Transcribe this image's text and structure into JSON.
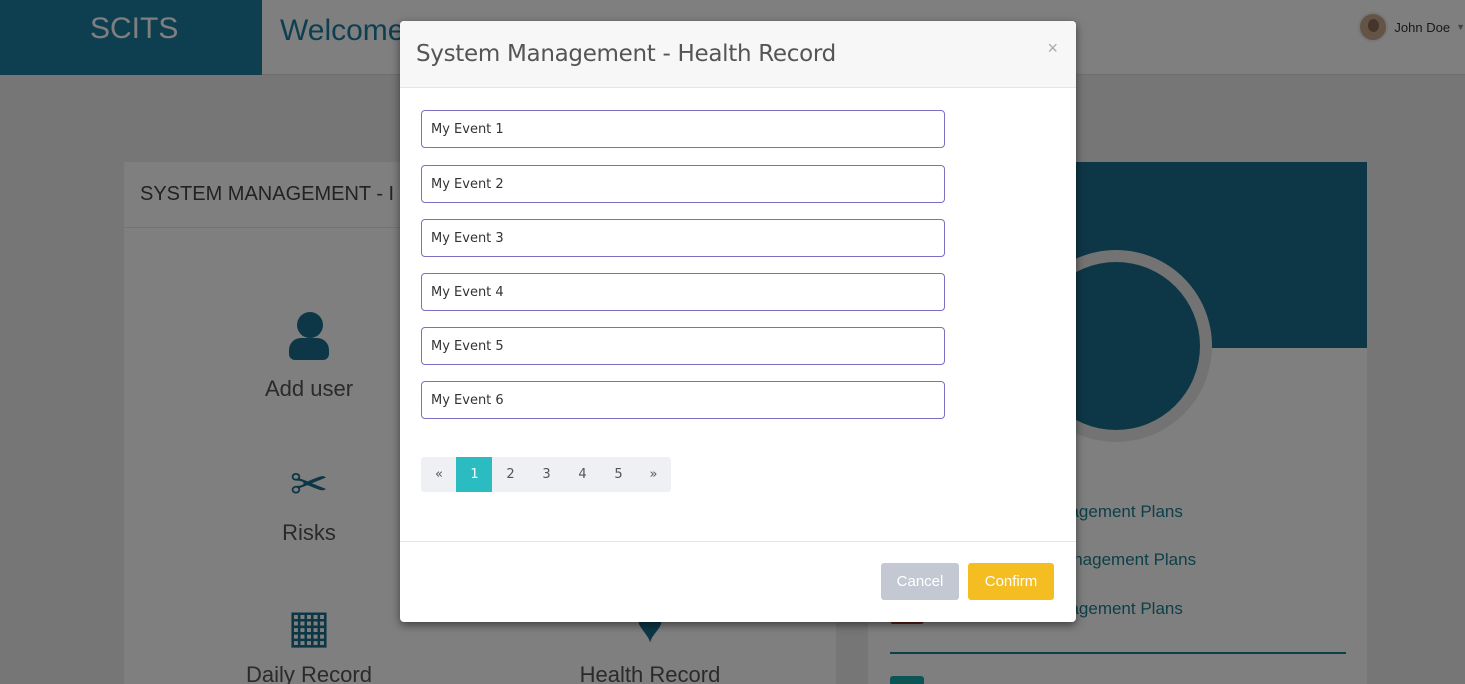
{
  "app": {
    "brand": "SCITS",
    "welcome": "Welcome",
    "user_name": "John Doe"
  },
  "background": {
    "left_panel_title": "SYSTEM MANAGEMENT - I",
    "tiles": [
      "Add user",
      "Risks",
      "Daily Record",
      "Health Record"
    ],
    "plan_links": [
      "nagement Plans",
      "lanagement Plans",
      "nagement Plans"
    ]
  },
  "modal": {
    "title": "System Management - Health Record",
    "close": "×",
    "events": [
      "My Event 1",
      "My Event 2",
      "My Event 3",
      "My Event 4",
      "My Event 5",
      "My Event 6"
    ],
    "pagination": {
      "prev": "«",
      "pages": [
        "1",
        "2",
        "3",
        "4",
        "5"
      ],
      "next": "»",
      "active_page": "1"
    },
    "cancel_label": "Cancel",
    "confirm_label": "Confirm"
  },
  "colors": {
    "brand": "#1a7fa3",
    "accent_teal": "#2bbcc2",
    "confirm": "#f4be22",
    "cancel": "#c4c8d3",
    "input_border": "#7b6fc4"
  }
}
